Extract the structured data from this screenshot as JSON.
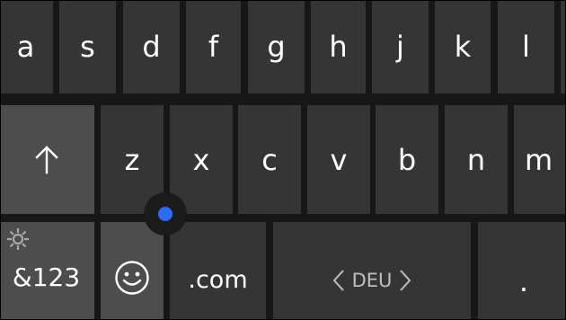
{
  "keyboard": {
    "row1": [
      "a",
      "s",
      "d",
      "f",
      "g",
      "h",
      "j",
      "k",
      "l"
    ],
    "row2": [
      "z",
      "x",
      "c",
      "v",
      "b",
      "n",
      "m"
    ],
    "shift_icon": "arrow-up-icon",
    "symbols_label": "&123",
    "settings_icon": "gear-icon",
    "emoji_icon": "smiley-icon",
    "dotcom_label": ".com",
    "language": {
      "label": "DEU",
      "prev_icon": "chevron-left-icon",
      "next_icon": "chevron-right-icon"
    },
    "period_label": ".",
    "cursor_control_icon": "cursor-dot-icon"
  },
  "colors": {
    "background": "#171717",
    "key": "#353535",
    "function_key": "#4d4d4d",
    "text": "#ffffff",
    "cursor_accent": "#2e6cf5"
  }
}
